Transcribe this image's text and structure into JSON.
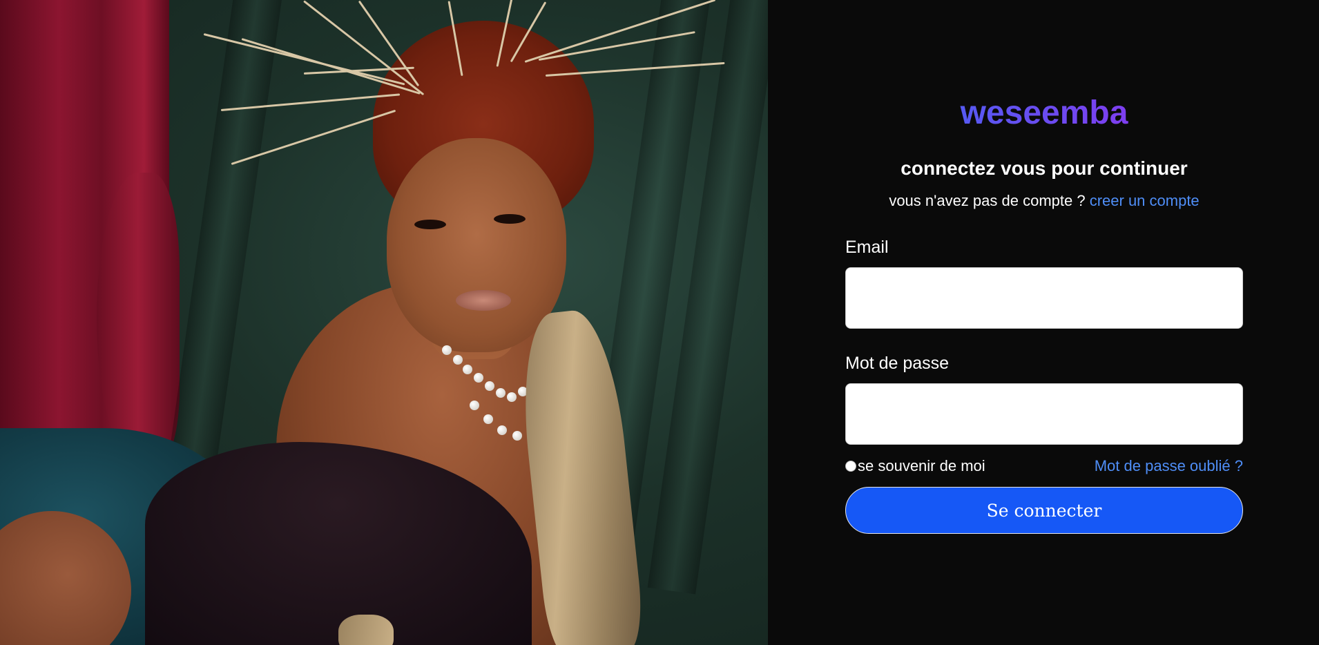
{
  "hero": {
    "image_description": "portrait-photo"
  },
  "brand": {
    "logo_text": "weseemba",
    "gradient_start": "#3b6cf6",
    "gradient_end": "#9a2cf0"
  },
  "login": {
    "heading": "connectez vous pour continuer",
    "no_account_text": "vous n'avez pas de compte ?",
    "create_account_link": "creer un compte",
    "email_label": "Email",
    "email_value": "",
    "email_placeholder": "",
    "password_label": "Mot de passe",
    "password_value": "",
    "password_placeholder": "",
    "remember_me_label": "se souvenir de moi",
    "forgot_password_link": "Mot de passe oublié ?",
    "submit_label": "Se connecter"
  },
  "colors": {
    "background": "#0a0a0a",
    "link": "#4f8ef7",
    "button": "#1658f6"
  }
}
